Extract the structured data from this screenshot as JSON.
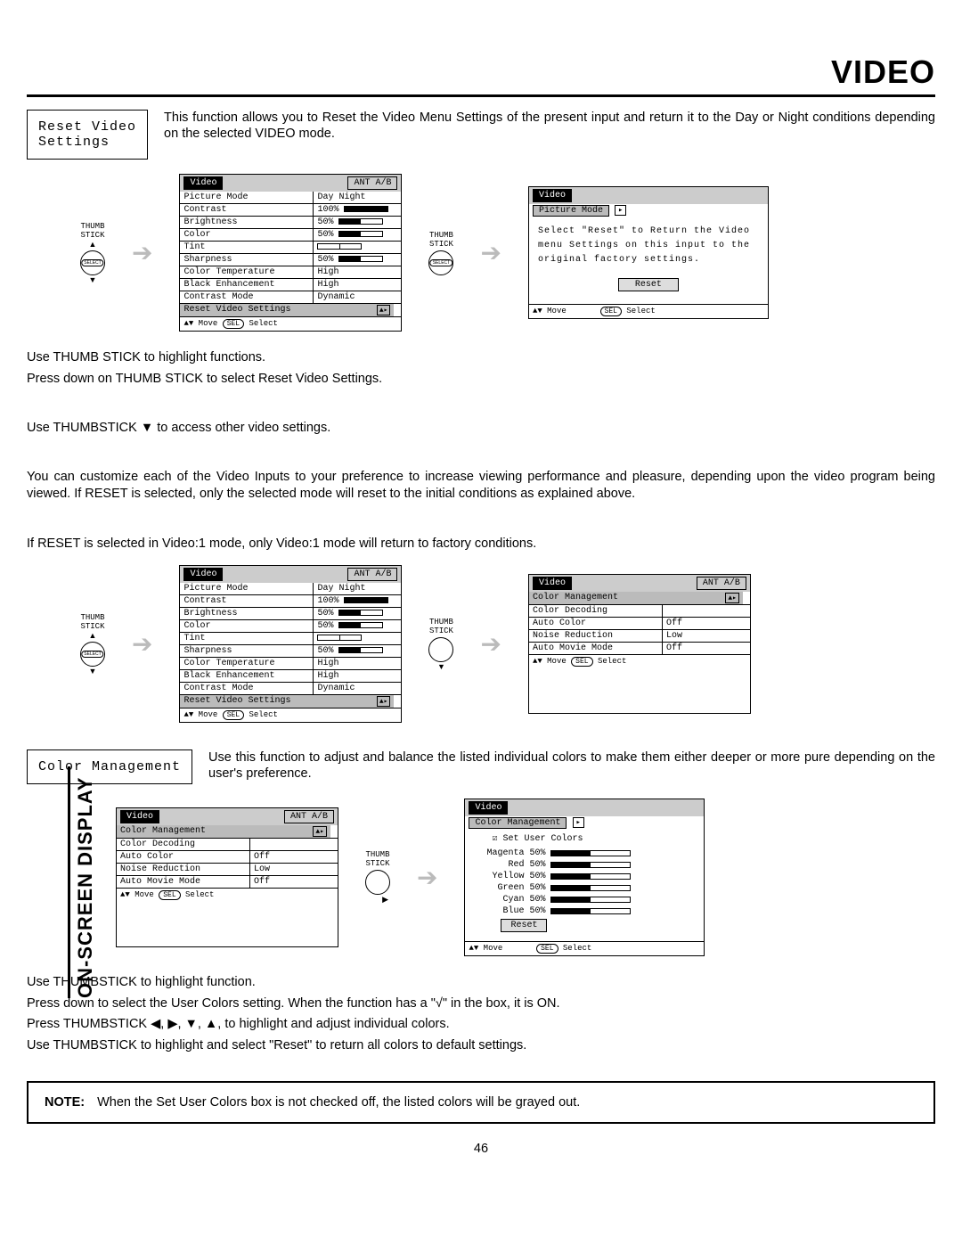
{
  "page_title": "VIDEO",
  "side_tab": "ON-SCREEN DISPLAY",
  "page_number": "46",
  "reset_section": {
    "label": "Reset Video\nSettings",
    "text": "This function allows you to Reset the Video Menu Settings of the present input and return it to the Day or Night conditions depending on the selected VIDEO mode."
  },
  "thumbstick_label": "THUMB\nSTICK",
  "select_label": "SELECT",
  "arrow_between": "➔",
  "osd1_left": {
    "title_tab": "Video",
    "ant_tab": "ANT A/B",
    "rows": [
      {
        "name": "Picture Mode",
        "val": "Day     Night",
        "hl": false,
        "type": "text"
      },
      {
        "name": "Contrast",
        "val": "100%",
        "hl": false,
        "type": "bar",
        "pct": 100
      },
      {
        "name": "Brightness",
        "val": "50%",
        "hl": false,
        "type": "bar",
        "pct": 50
      },
      {
        "name": "Color",
        "val": "50%",
        "hl": false,
        "type": "bar",
        "pct": 50
      },
      {
        "name": "Tint",
        "val": "",
        "hl": false,
        "type": "center"
      },
      {
        "name": "Sharpness",
        "val": "50%",
        "hl": false,
        "type": "bar",
        "pct": 50
      },
      {
        "name": "Color Temperature",
        "val": "High",
        "hl": false,
        "type": "text"
      },
      {
        "name": "Black Enhancement",
        "val": "High",
        "hl": false,
        "type": "text"
      },
      {
        "name": "Contrast Mode",
        "val": "Dynamic",
        "hl": false,
        "type": "text"
      },
      {
        "name": "Reset Video Settings",
        "val": "",
        "hl": true,
        "type": "arrow"
      }
    ],
    "footer": "▲▼ Move  SEL Select"
  },
  "osd1_right": {
    "title_tab": "Video",
    "sub": "Picture Mode",
    "msg": "Select \"Reset\" to Return the Video menu Settings on this input to the original factory settings.",
    "button": "Reset",
    "footer": "▲▼ Move        SEL Select"
  },
  "instructions_block1": [
    "Use THUMB STICK to highlight functions.",
    "Press down on THUMB STICK to select Reset Video Settings.",
    "",
    "Use THUMBSTICK ▼ to access other video settings.",
    "",
    "You can customize each of the Video Inputs to your preference to increase viewing performance and pleasure, depending upon the video program being viewed. If RESET is selected, only the selected mode will reset to the initial conditions as explained above.",
    "",
    "If RESET is selected in Video:1 mode, only Video:1 mode will return to factory conditions."
  ],
  "osd2_left": {
    "title_tab": "Video",
    "ant_tab": "ANT A/B",
    "rows": [
      {
        "name": "Picture Mode",
        "val": "Day     Night",
        "type": "text"
      },
      {
        "name": "Contrast",
        "val": "100%",
        "type": "bar",
        "pct": 100
      },
      {
        "name": "Brightness",
        "val": "50%",
        "type": "bar",
        "pct": 50
      },
      {
        "name": "Color",
        "val": "50%",
        "type": "bar",
        "pct": 50
      },
      {
        "name": "Tint",
        "val": "",
        "type": "center"
      },
      {
        "name": "Sharpness",
        "val": "50%",
        "type": "bar",
        "pct": 50
      },
      {
        "name": "Color Temperature",
        "val": "High",
        "type": "text"
      },
      {
        "name": "Black Enhancement",
        "val": "High",
        "type": "text"
      },
      {
        "name": "Contrast Mode",
        "val": "Dynamic",
        "type": "text"
      },
      {
        "name": "Reset Video Settings",
        "val": "",
        "type": "arrow",
        "hl": true
      }
    ],
    "footer": "▲▼ Move  SEL Select"
  },
  "osd2_right": {
    "title_tab": "Video",
    "ant_tab": "ANT A/B",
    "rows": [
      {
        "name": "Color Management",
        "val": "",
        "type": "arrow",
        "hl": true
      },
      {
        "name": "Color Decoding",
        "val": "",
        "type": "text"
      },
      {
        "name": "Auto Color",
        "val": "Off",
        "type": "text"
      },
      {
        "name": "Noise Reduction",
        "val": "Low",
        "type": "text"
      },
      {
        "name": "Auto Movie Mode",
        "val": "Off",
        "type": "text"
      }
    ],
    "footer": "▲▼ Move  SEL Select"
  },
  "color_mgmt_section": {
    "label": "Color Management",
    "text": "Use this function to adjust and balance the listed individual colors to make them either deeper or more pure depending on the user's preference."
  },
  "osd3_left": {
    "title_tab": "Video",
    "ant_tab": "ANT A/B",
    "rows": [
      {
        "name": "Color Management",
        "val": "",
        "type": "arrow",
        "hl": true
      },
      {
        "name": "Color Decoding",
        "val": "",
        "type": "text"
      },
      {
        "name": "Auto Color",
        "val": "Off",
        "type": "text"
      },
      {
        "name": "Noise Reduction",
        "val": "Low",
        "type": "text"
      },
      {
        "name": "Auto Movie Mode",
        "val": "Off",
        "type": "text"
      }
    ],
    "footer": "▲▼ Move  SEL Select"
  },
  "osd3_right": {
    "title_tab": "Video",
    "sub": "Color Management",
    "check_label": "☑ Set User Colors",
    "colors": [
      {
        "name": "Magenta",
        "val": "50%"
      },
      {
        "name": "Red",
        "val": "50%"
      },
      {
        "name": "Yellow",
        "val": "50%"
      },
      {
        "name": "Green",
        "val": "50%"
      },
      {
        "name": "Cyan",
        "val": "50%"
      },
      {
        "name": "Blue",
        "val": "50%"
      }
    ],
    "reset": "Reset",
    "footer": "▲▼ Move        SEL Select"
  },
  "instructions_block2": [
    "Use THUMBSTICK to highlight function.",
    "Press down to select the User Colors setting.  When the function has a \"√\" in the box, it is ON.",
    "Press THUMBSTICK ◀, ▶, ▼, ▲, to highlight and adjust individual colors.",
    "Use THUMBSTICK to highlight and select \"Reset\" to return all colors to default settings."
  ],
  "note": {
    "label": "NOTE:",
    "text": "When the Set User Colors box is not checked off, the listed colors will be grayed out."
  }
}
